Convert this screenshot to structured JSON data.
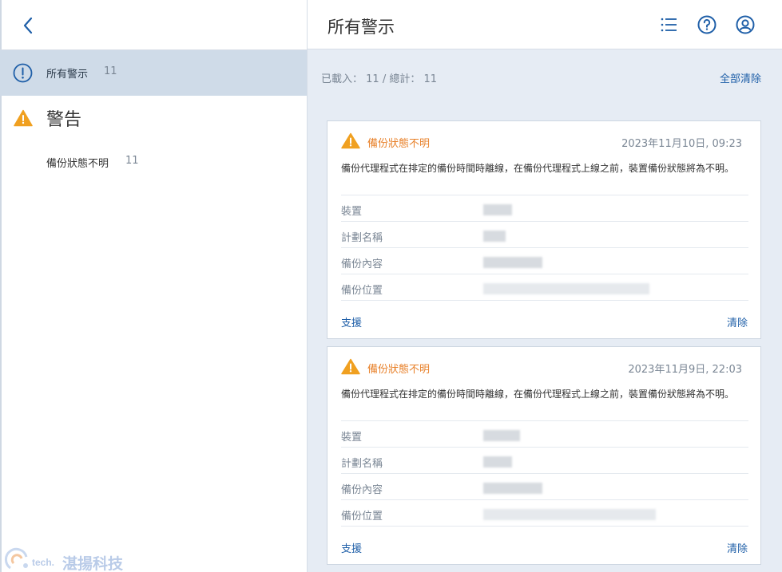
{
  "sidebar": {
    "all_alerts": {
      "label": "所有警示",
      "count": "11"
    },
    "section": {
      "label": "警告"
    },
    "items": [
      {
        "label": "備份狀態不明",
        "count": "11"
      }
    ]
  },
  "header": {
    "title": "所有警示"
  },
  "summary": {
    "loaded_label": "已載入：",
    "loaded": "11",
    "sep": "/",
    "total_label": "總計：",
    "total": "11"
  },
  "clear_all_label": "全部清除",
  "alerts": [
    {
      "title": "備份狀態不明",
      "date": "2023年11月10日, 09:23",
      "description": "備份代理程式在排定的備份時間時離線，在備份代理程式上線之前，裝置備份狀態將為不明。",
      "fields": [
        {
          "label": "裝置"
        },
        {
          "label": "計劃名稱"
        },
        {
          "label": "備份內容"
        },
        {
          "label": "備份位置"
        }
      ],
      "support_label": "支援",
      "clear_label": "清除"
    },
    {
      "title": "備份狀態不明",
      "date": "2023年11月9日, 22:03",
      "description": "備份代理程式在排定的備份時間時離線，在備份代理程式上線之前，裝置備份狀態將為不明。",
      "fields": [
        {
          "label": "裝置"
        },
        {
          "label": "計劃名稱"
        },
        {
          "label": "備份內容"
        },
        {
          "label": "備份位置"
        }
      ],
      "support_label": "支援",
      "clear_label": "清除"
    }
  ],
  "watermark": {
    "tech": "tech.",
    "brand": "湛揚科技"
  },
  "colors": {
    "accent": "#1f5fa8",
    "warning": "#f0a020",
    "warning_text": "#e8812a",
    "selected_bg": "#cfdbe8",
    "main_bg": "#e6ecf4"
  },
  "icons": {
    "back": "chevron-left-icon",
    "list": "list-icon",
    "help": "help-circle-icon",
    "account": "user-circle-icon",
    "info": "info-circle-icon",
    "warning": "warning-triangle-icon"
  }
}
